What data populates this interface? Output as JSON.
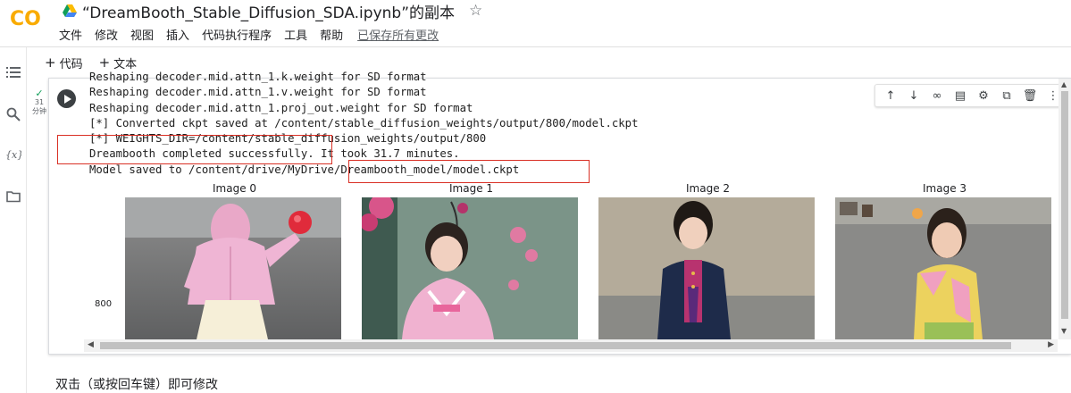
{
  "header": {
    "logo_text": "CO",
    "title": "“DreamBooth_Stable_Diffusion_SDA.ipynb”的副本",
    "menu": [
      "文件",
      "修改",
      "视图",
      "插入",
      "代码执行程序",
      "工具",
      "帮助"
    ],
    "saved_status": "已保存所有更改"
  },
  "toolbar": {
    "add_code": "代码",
    "add_text": "文本"
  },
  "cell": {
    "exec_count": "31",
    "exec_unit": "分钟",
    "output_lines": [
      "Reshaping decoder.mid.attn_1.k.weight for SD format",
      "Reshaping decoder.mid.attn_1.v.weight for SD format",
      "Reshaping decoder.mid.attn_1.proj_out.weight for SD format",
      "[*] Converted ckpt saved at /content/stable_diffusion_weights/output/800/model.ckpt",
      "[*] WEIGHTS_DIR=/content/stable_diffusion_weights/output/800",
      "Dreambooth completed successfully. It took 31.7 minutes.",
      "Model saved to /content/drive/MyDrive/Dreambooth_model/model.ckpt"
    ],
    "images": [
      {
        "label": "Image 0"
      },
      {
        "label": "Image 1"
      },
      {
        "label": "Image 2"
      },
      {
        "label": "Image 3"
      }
    ],
    "row_label": "800"
  },
  "footer": {
    "markdown_hint": "双击（或按回车键）即可修改"
  },
  "colors": {
    "highlight": "#d93025",
    "logo_orange": "#f9ab00",
    "run_button": "#3c4043"
  }
}
